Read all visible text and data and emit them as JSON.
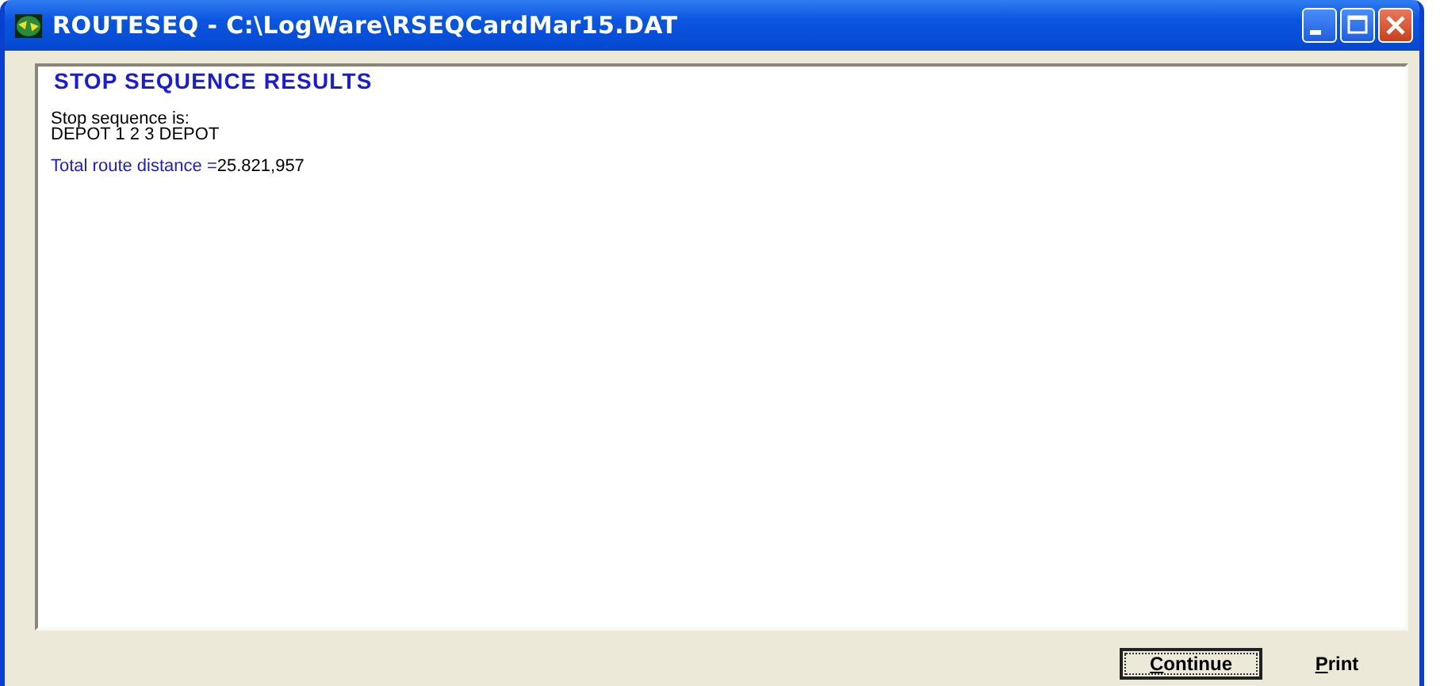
{
  "window": {
    "title": "ROUTESEQ - C:\\LogWare\\RSEQCardMar15.DAT"
  },
  "results": {
    "heading": "STOP SEQUENCE RESULTS",
    "sequence_label": "Stop sequence is:",
    "sequence": "DEPOT 1 2 3 DEPOT",
    "distance_label": "Total route distance =",
    "distance_value": "25.821,957"
  },
  "buttons": [
    {
      "label": "Continue",
      "default": true
    },
    {
      "label": "Print",
      "default": false
    }
  ]
}
